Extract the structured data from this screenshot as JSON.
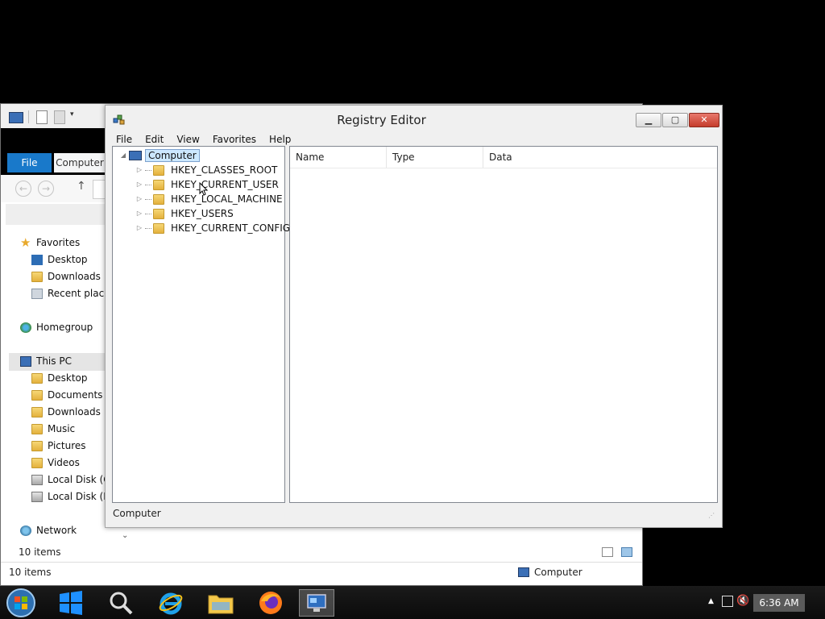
{
  "explorer": {
    "tabs": {
      "file": "File",
      "computer": "Computer"
    },
    "nav": {
      "favorites": "Favorites",
      "desktop": "Desktop",
      "downloads": "Downloads",
      "recent_places": "Recent places",
      "homegroup": "Homegroup",
      "this_pc": "This PC",
      "pc_desktop": "Desktop",
      "documents": "Documents",
      "pc_downloads": "Downloads",
      "music": "Music",
      "pictures": "Pictures",
      "videos": "Videos",
      "local_disk_c": "Local Disk (C:",
      "local_disk_d": "Local Disk (D:",
      "network": "Network"
    },
    "status": {
      "items_inner": "10 items",
      "items_outer": "10 items",
      "location": "Computer"
    }
  },
  "regedit": {
    "title": "Registry Editor",
    "menu": [
      "File",
      "Edit",
      "View",
      "Favorites",
      "Help"
    ],
    "tree": {
      "root": "Computer",
      "keys": [
        "HKEY_CLASSES_ROOT",
        "HKEY_CURRENT_USER",
        "HKEY_LOCAL_MACHINE",
        "HKEY_USERS",
        "HKEY_CURRENT_CONFIG"
      ]
    },
    "columns": [
      "Name",
      "Type",
      "Data"
    ],
    "status": "Computer"
  },
  "taskbar": {
    "clock": "6:36 AM",
    "pinned": [
      "start-button",
      "windows-store-icon",
      "search-icon",
      "internet-explorer-icon",
      "file-explorer-icon",
      "firefox-icon",
      "registry-editor-icon"
    ]
  },
  "colors": {
    "accent": "#1979ca",
    "selection": "#cce8ff",
    "close": "#c43c2c"
  }
}
